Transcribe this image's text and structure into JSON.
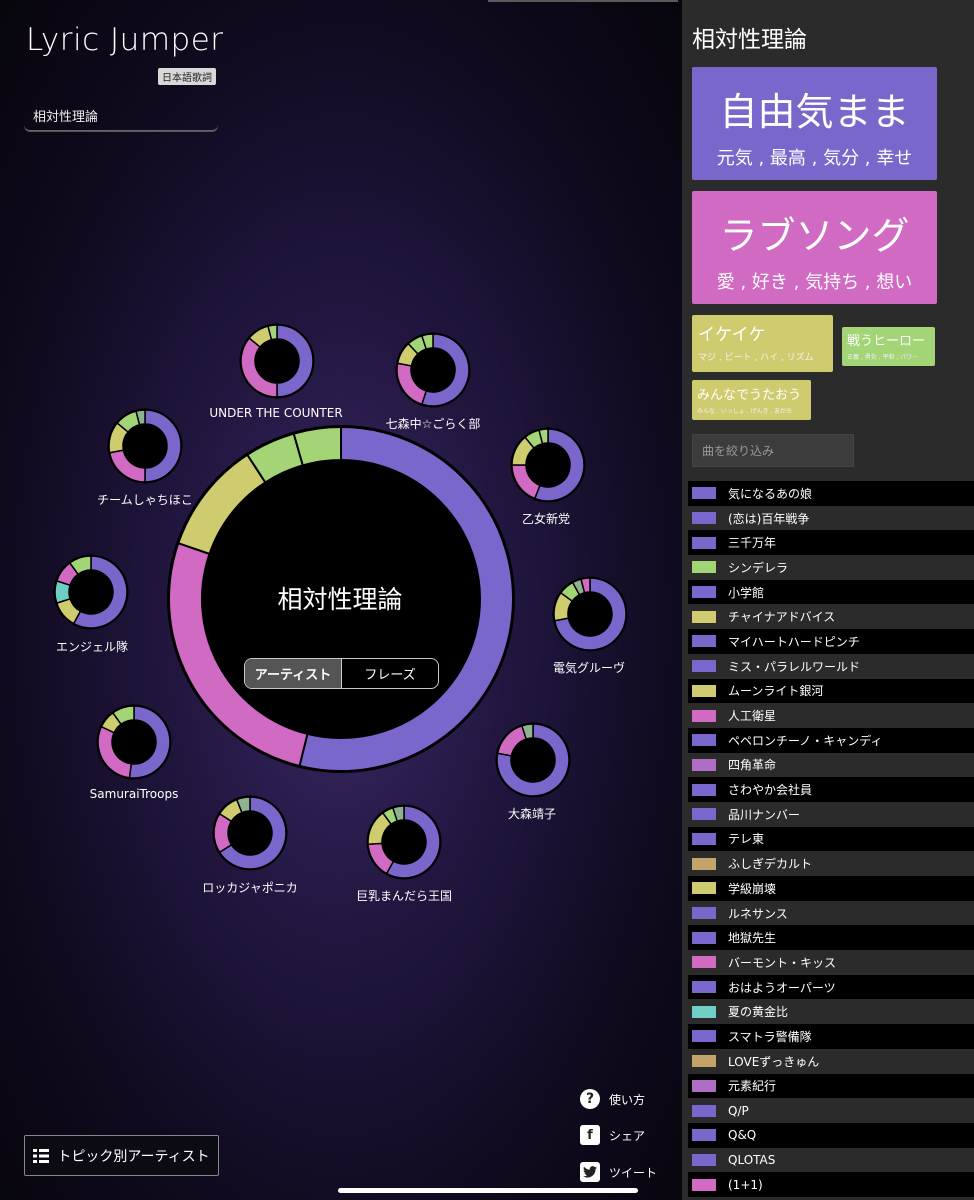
{
  "app": {
    "title": "Lyric Jumper",
    "language_badge": "日本語歌詞",
    "song_field": "相対性理論"
  },
  "center": {
    "artist": "相対性理論",
    "toggle": [
      "アーティスト",
      "フレーズ"
    ]
  },
  "colors": {
    "purple": "#7b67cc",
    "pink": "#d06ac2",
    "yellow": "#cfcc70",
    "green": "#a3d475",
    "grey": "#8fb391",
    "teal": "#6fcfc5",
    "tan": "#c4a36a",
    "orchid": "#b06dc6"
  },
  "main_ring": {
    "segments": [
      {
        "color": "#7b67cc",
        "value": 0.535
      },
      {
        "color": "#d06ac2",
        "value": 0.262
      },
      {
        "color": "#cfcc70",
        "value": 0.105
      },
      {
        "color": "#a3d475",
        "value": 0.047
      },
      {
        "color": "#a3d475",
        "value": 0.044
      }
    ]
  },
  "related_artists": [
    {
      "name": "UNDER THE COUNTER",
      "segments": [
        {
          "color": "#7b67cc",
          "value": 0.5
        },
        {
          "color": "#d06ac2",
          "value": 0.36
        },
        {
          "color": "#cfcc70",
          "value": 0.1
        },
        {
          "color": "#a3d475",
          "value": 0.04
        }
      ]
    },
    {
      "name": "七森中☆ごらく部",
      "segments": [
        {
          "color": "#7b67cc",
          "value": 0.55
        },
        {
          "color": "#d06ac2",
          "value": 0.23
        },
        {
          "color": "#cfcc70",
          "value": 0.1
        },
        {
          "color": "#a3d475",
          "value": 0.07
        },
        {
          "color": "#a3d475",
          "value": 0.05
        }
      ]
    },
    {
      "name": "乙女新党",
      "segments": [
        {
          "color": "#7b67cc",
          "value": 0.56
        },
        {
          "color": "#d06ac2",
          "value": 0.19
        },
        {
          "color": "#cfcc70",
          "value": 0.14
        },
        {
          "color": "#a3d475",
          "value": 0.07
        },
        {
          "color": "#a3d475",
          "value": 0.04
        }
      ]
    },
    {
      "name": "電気グルーヴ",
      "segments": [
        {
          "color": "#7b67cc",
          "value": 0.72
        },
        {
          "color": "#cfcc70",
          "value": 0.13
        },
        {
          "color": "#a3d475",
          "value": 0.07
        },
        {
          "color": "#8fb391",
          "value": 0.04
        },
        {
          "color": "#d06ac2",
          "value": 0.04
        }
      ]
    },
    {
      "name": "大森靖子",
      "segments": [
        {
          "color": "#7b67cc",
          "value": 0.78
        },
        {
          "color": "#d06ac2",
          "value": 0.17
        },
        {
          "color": "#8fb391",
          "value": 0.05
        }
      ]
    },
    {
      "name": "巨乳まんだら王国",
      "segments": [
        {
          "color": "#7b67cc",
          "value": 0.58
        },
        {
          "color": "#d06ac2",
          "value": 0.16
        },
        {
          "color": "#cfcc70",
          "value": 0.16
        },
        {
          "color": "#a3d475",
          "value": 0.05
        },
        {
          "color": "#8fb391",
          "value": 0.05
        }
      ]
    },
    {
      "name": "ロッカジャポニカ",
      "segments": [
        {
          "color": "#7b67cc",
          "value": 0.66
        },
        {
          "color": "#d06ac2",
          "value": 0.18
        },
        {
          "color": "#cfcc70",
          "value": 0.1
        },
        {
          "color": "#8fb391",
          "value": 0.06
        }
      ]
    },
    {
      "name": "SamuraiTroops",
      "segments": [
        {
          "color": "#7b67cc",
          "value": 0.52
        },
        {
          "color": "#d06ac2",
          "value": 0.3
        },
        {
          "color": "#cfcc70",
          "value": 0.08
        },
        {
          "color": "#a3d475",
          "value": 0.1
        }
      ]
    },
    {
      "name": "エンジェル隊",
      "segments": [
        {
          "color": "#7b67cc",
          "value": 0.58
        },
        {
          "color": "#cfcc70",
          "value": 0.12
        },
        {
          "color": "#6fcfc5",
          "value": 0.1
        },
        {
          "color": "#d06ac2",
          "value": 0.1
        },
        {
          "color": "#a3d475",
          "value": 0.1
        }
      ]
    },
    {
      "name": "チームしゃちほこ",
      "segments": [
        {
          "color": "#7b67cc",
          "value": 0.5
        },
        {
          "color": "#d06ac2",
          "value": 0.22
        },
        {
          "color": "#cfcc70",
          "value": 0.14
        },
        {
          "color": "#a3d475",
          "value": 0.1
        },
        {
          "color": "#8fb391",
          "value": 0.04
        }
      ]
    }
  ],
  "footer": {
    "topic_button": "トピック別アーティスト",
    "help": "使い方",
    "share": "シェア",
    "tweet": "ツイート"
  },
  "panel": {
    "title": "相対性理論",
    "topics": [
      {
        "title": "自由気まま",
        "keywords": "元気 , 最高 , 気分 , 幸せ",
        "color": "#7b67cc"
      },
      {
        "title": "ラブソング",
        "keywords": "愛 , 好き , 気持ち , 想い",
        "color": "#d06ac2"
      },
      {
        "title": "イケイケ",
        "keywords": "マジ , ビート , ハイ , リズム",
        "color": "#cfcc70"
      },
      {
        "title": "戦うヒーロー",
        "keywords": "正義 , 勇気 , 平和 , パワー",
        "color": "#a3d475"
      },
      {
        "title": "みんなでうたおう",
        "keywords": "みんな , いっしょ , げんき , 友だち",
        "color": "#cfcc70"
      }
    ],
    "filter_placeholder": "曲を絞り込み",
    "songs": [
      {
        "title": "気になるあの娘",
        "color": "#7b67cc"
      },
      {
        "title": "(恋は)百年戦争",
        "color": "#7b67cc"
      },
      {
        "title": "三千万年",
        "color": "#7b67cc"
      },
      {
        "title": "シンデレラ",
        "color": "#a3d475"
      },
      {
        "title": "小学館",
        "color": "#7b67cc"
      },
      {
        "title": "チャイナアドバイス",
        "color": "#cfcc70"
      },
      {
        "title": "マイハートハードピンチ",
        "color": "#7b67cc"
      },
      {
        "title": "ミス・パラレルワールド",
        "color": "#7b67cc"
      },
      {
        "title": "ムーンライト銀河",
        "color": "#cfcc70"
      },
      {
        "title": "人工衛星",
        "color": "#d06ac2"
      },
      {
        "title": "ペペロンチーノ・キャンディ",
        "color": "#7b67cc"
      },
      {
        "title": "四角革命",
        "color": "#b06dc6"
      },
      {
        "title": "さわやか会社員",
        "color": "#7b67cc"
      },
      {
        "title": "品川ナンバー",
        "color": "#7b67cc"
      },
      {
        "title": "テレ東",
        "color": "#7b67cc"
      },
      {
        "title": "ふしぎデカルト",
        "color": "#c4a36a"
      },
      {
        "title": "学級崩壊",
        "color": "#cfcc70"
      },
      {
        "title": "ルネサンス",
        "color": "#7b67cc"
      },
      {
        "title": "地獄先生",
        "color": "#7b67cc"
      },
      {
        "title": "バーモント・キッス",
        "color": "#d06ac2"
      },
      {
        "title": "おはようオーパーツ",
        "color": "#7b67cc"
      },
      {
        "title": "夏の黄金比",
        "color": "#6fcfc5"
      },
      {
        "title": "スマトラ警備隊",
        "color": "#7b67cc"
      },
      {
        "title": "LOVEずっきゅん",
        "color": "#c4a36a"
      },
      {
        "title": "元素紀行",
        "color": "#b06dc6"
      },
      {
        "title": "Q/P",
        "color": "#7b67cc"
      },
      {
        "title": "Q&Q",
        "color": "#7b67cc"
      },
      {
        "title": "QLOTAS",
        "color": "#7b67cc"
      },
      {
        "title": "(1+1)",
        "color": "#d06ac2"
      }
    ]
  }
}
